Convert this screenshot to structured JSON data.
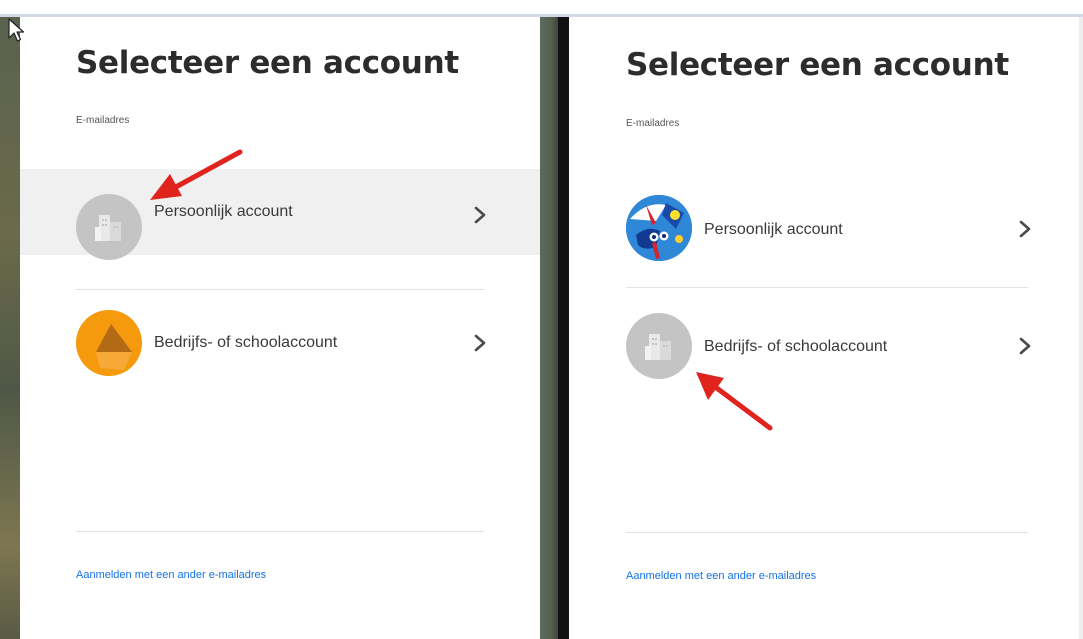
{
  "left_panel": {
    "title": "Selecteer een account",
    "email_label": "E-mailadres",
    "accounts": [
      {
        "label": "Persoonlijk account",
        "avatar": "building-icon",
        "selected": true
      },
      {
        "label": "Bedrijfs- of schoolaccount",
        "avatar": "orange-shape-avatar",
        "selected": false
      }
    ],
    "other_email_link": "Aanmelden met een ander e-mailadres"
  },
  "right_panel": {
    "title": "Selecteer een account",
    "email_label": "E-mailadres",
    "accounts": [
      {
        "label": "Persoonlijk account",
        "avatar": "colorful-artwork-avatar",
        "selected": false
      },
      {
        "label": "Bedrijfs- of schoolaccount",
        "avatar": "building-icon",
        "selected": false
      }
    ],
    "other_email_link": "Aanmelden met een ander e-mailadres"
  },
  "colors": {
    "link": "#1473e6",
    "highlight_row": "#f0f0f0",
    "annotation_arrow": "#e0231c",
    "orange_avatar": "#f59a0c",
    "gray_avatar": "#c4c4c4"
  }
}
